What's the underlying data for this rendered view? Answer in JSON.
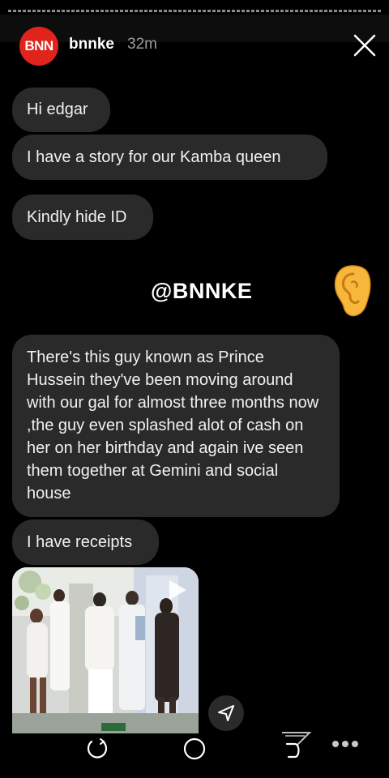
{
  "story": {
    "username": "bnnke",
    "time_ago": "32m",
    "avatar_text": "BNN"
  },
  "messages": [
    "Hi edgar",
    "I have a story for our Kamba queen",
    "Kindly hide ID",
    "There's this guy known as Prince Hussein they've been moving around with our gal for almost three months now ,the guy even splashed alot of cash on her on her  birthday and again ive seen them together at Gemini and social house",
    "I have receipts"
  ],
  "watermark": "@BNNKE",
  "icons": {
    "close": "close-icon",
    "ear": "ear-icon",
    "play": "play-icon",
    "send": "send-icon",
    "nav": [
      "recents-icon",
      "home-icon",
      "back-icon",
      "more-icon"
    ]
  },
  "colors": {
    "background": "#000000",
    "bubble": "#2a2a2a",
    "avatar": "#e0241c"
  }
}
